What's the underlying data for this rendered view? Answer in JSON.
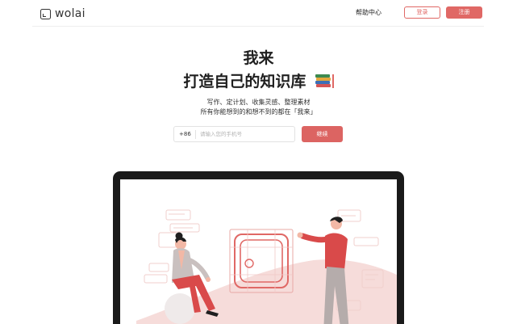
{
  "header": {
    "logo_text": "wolai",
    "help_label": "帮助中心",
    "login_label": "登录",
    "signup_label": "注册"
  },
  "hero": {
    "title_line1": "我来",
    "title_line2": "打造自己的知识库",
    "subtitle_line1": "写作、定计划、收集灵感、整理素材",
    "subtitle_line2": "所有你能想到的和想不到的都在「我来」"
  },
  "signup_form": {
    "country_code": "+86",
    "phone_placeholder": "请输入您的手机号",
    "phone_value": "",
    "continue_label": "继续"
  },
  "icons": {
    "logo": "wolai-logo-icon",
    "emoji": "books-icon"
  },
  "colors": {
    "accent": "#e06865",
    "accent_light": "#f6d9d7",
    "text": "#1f1f1f",
    "laptop": "#1a1a1a"
  }
}
